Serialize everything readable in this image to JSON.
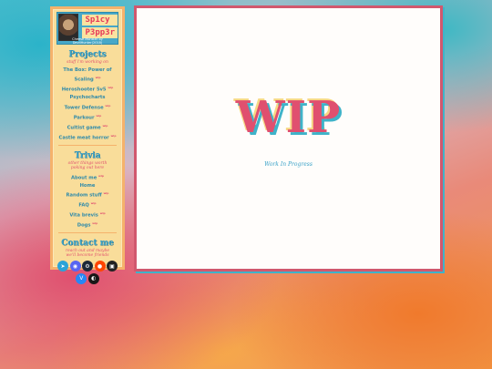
{
  "sidebar": {
    "title_line1": "Sp1cy",
    "title_line2": "P3pp3r",
    "credit": "Cheese Monster by  DevilHunter(2018)",
    "projects": {
      "title": "Projects",
      "subtitle": "stuff i'm working on",
      "items": [
        {
          "label": "The Box: Power of Scaling",
          "badge": "wip"
        },
        {
          "label": "Heroshooter 5v5",
          "badge": "wip"
        },
        {
          "label": "Psychocharts",
          "badge": ""
        },
        {
          "label": "Tower Defense",
          "badge": "wip"
        },
        {
          "label": "Parkour",
          "badge": "wip"
        },
        {
          "label": "Cultist game",
          "badge": "wip"
        },
        {
          "label": "Castle meat horror",
          "badge": "wip"
        }
      ]
    },
    "trivia": {
      "title": "Trivia",
      "subtitle": "other things worth poking out here",
      "items": [
        {
          "label": "About me",
          "badge": "wip"
        },
        {
          "label": "Home",
          "badge": ""
        },
        {
          "label": "Random stuff",
          "badge": "wip"
        },
        {
          "label": "FAQ",
          "badge": "wip"
        },
        {
          "label": "Vita brevis",
          "badge": "wip"
        },
        {
          "label": "Dogs",
          "badge": "wip"
        }
      ]
    },
    "contact": {
      "title": "Contact me",
      "subtitle": "reach out and maybe we'll become friends",
      "icons": [
        {
          "name": "telegram-icon",
          "color": "#2aa3d8",
          "glyph": "➤"
        },
        {
          "name": "discord-icon",
          "color": "#5865f2",
          "glyph": "◉"
        },
        {
          "name": "steam-icon",
          "color": "#1b2838",
          "glyph": "⚙"
        },
        {
          "name": "reddit-icon",
          "color": "#ff4500",
          "glyph": "●"
        },
        {
          "name": "itch-icon",
          "color": "#222222",
          "glyph": "▣"
        },
        {
          "name": "vk-icon",
          "color": "#2787f5",
          "glyph": "V"
        },
        {
          "name": "github-icon",
          "color": "#181717",
          "glyph": "◐"
        }
      ]
    }
  },
  "main": {
    "heading": "WIP",
    "subtitle": "Work In Progress"
  }
}
